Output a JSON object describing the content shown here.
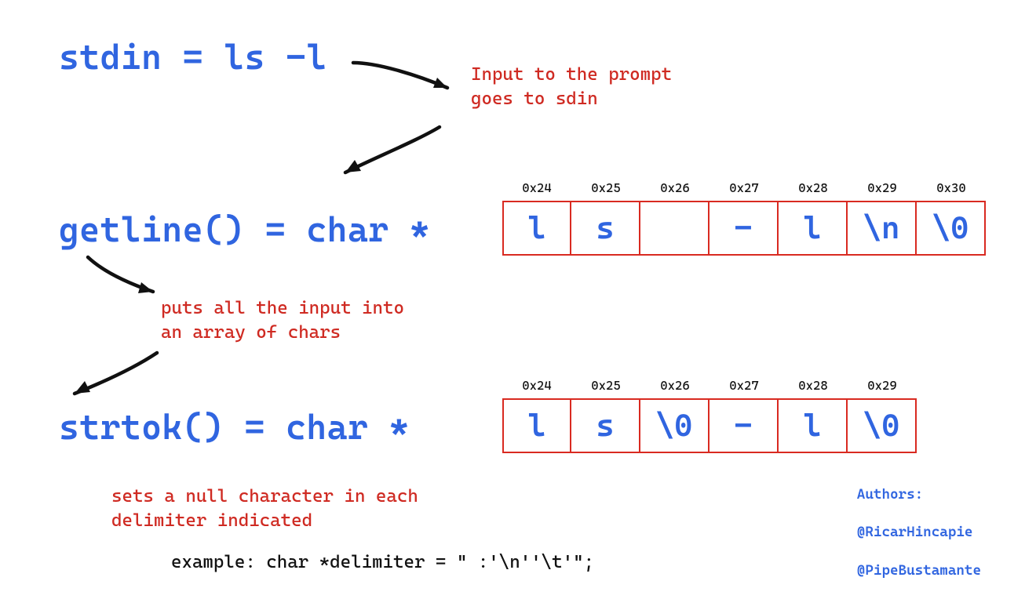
{
  "lines": {
    "stdin": "stdin = ls -l",
    "getline": "getline() = char *",
    "strtok": "strtok() = char *"
  },
  "annotations": {
    "input_prompt": "Input to the prompt\ngoes to sdin",
    "puts_array": "puts all the input into\nan array of chars",
    "sets_null": "sets a null character in each\ndelimiter indicated"
  },
  "example": "example: char *delimiter = \" :'\\n''\\t'\";",
  "mem_row1": [
    {
      "addr": "0x24",
      "val": "l"
    },
    {
      "addr": "0x25",
      "val": "s"
    },
    {
      "addr": "0x26",
      "val": " "
    },
    {
      "addr": "0x27",
      "val": "-"
    },
    {
      "addr": "0x28",
      "val": "l"
    },
    {
      "addr": "0x29",
      "val": "\\n"
    },
    {
      "addr": "0x30",
      "val": "\\0"
    }
  ],
  "mem_row2": [
    {
      "addr": "0x24",
      "val": "l"
    },
    {
      "addr": "0x25",
      "val": "s"
    },
    {
      "addr": "0x26",
      "val": "\\0"
    },
    {
      "addr": "0x27",
      "val": "-"
    },
    {
      "addr": "0x28",
      "val": "l"
    },
    {
      "addr": "0x29",
      "val": "\\0"
    }
  ],
  "authors": {
    "label": "Authors:",
    "a1": "@RicarHincapie",
    "a2": "@PipeBustamante"
  }
}
